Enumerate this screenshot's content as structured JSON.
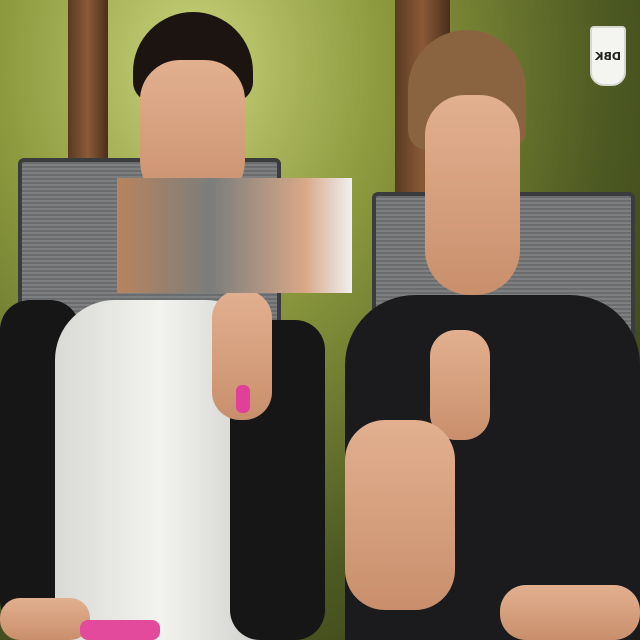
{
  "scene": {
    "description_colors": {
      "foliage": "#8d9a3e",
      "shirt_white": "#f2f2ef",
      "shirt_black": "#161616",
      "chair": "#7d7f80"
    }
  },
  "logo": {
    "text": "DBK",
    "mirrored": true
  }
}
